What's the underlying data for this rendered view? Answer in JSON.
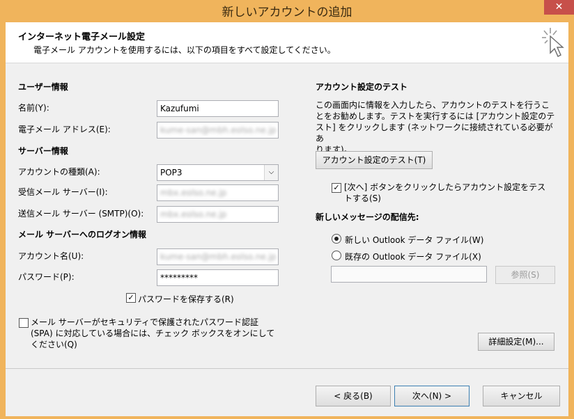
{
  "window": {
    "title": "新しいアカウントの追加",
    "close_glyph": "✕"
  },
  "header": {
    "title": "インターネット電子メール設定",
    "subtitle": "電子メール アカウントを使用するには、以下の項目をすべて設定してください。"
  },
  "user_info": {
    "section": "ユーザー情報",
    "name_label": "名前(Y):",
    "name_value": "Kazufumi",
    "email_label": "電子メール アドレス(E):",
    "email_value": "kume-san@mbh.eolso.ne.jp"
  },
  "server_info": {
    "section": "サーバー情報",
    "account_type_label": "アカウントの種類(A):",
    "account_type_value": "POP3",
    "incoming_label": "受信メール サーバー(I):",
    "incoming_value": "mbx.eolso.ne.jp",
    "outgoing_label": "送信メール サーバー (SMTP)(O):",
    "outgoing_value": "mbx.eolso.ne.jp"
  },
  "logon_info": {
    "section": "メール サーバーへのログオン情報",
    "account_name_label": "アカウント名(U):",
    "account_name_value": "kume-san@mbh.eolso.ne.jp",
    "password_label": "パスワード(P):",
    "password_value": "*********",
    "save_password_label": "パスワードを保存する(R)",
    "spa_label_1": "メール サーバーがセキュリティで保護されたパスワード認証",
    "spa_label_2": "(SPA) に対応している場合には、チェック ボックスをオンにして",
    "spa_label_3": "ください(Q)"
  },
  "test": {
    "section": "アカウント設定のテスト",
    "desc_1": "この画面内に情報を入力したら、アカウントのテストを行うこ",
    "desc_2": "とをお勧めします。テストを実行するには [アカウント設定のテ",
    "desc_3": "スト] をクリックします (ネットワークに接続されている必要があ",
    "desc_4": "ります)。",
    "test_button": "アカウント設定のテスト(T)",
    "auto_test_1": "[次へ] ボタンをクリックしたらアカウント設定をテス",
    "auto_test_2": "トする(S)"
  },
  "delivery": {
    "section": "新しいメッセージの配信先:",
    "new_file": "新しい Outlook データ ファイル(W)",
    "existing_file": "既存の Outlook データ ファイル(X)",
    "path_value": "",
    "browse_button": "参照(S)"
  },
  "buttons": {
    "more_settings": "詳細設定(M)...",
    "back": "< 戻る(B)",
    "next": "次へ(N) >",
    "cancel": "キャンセル"
  },
  "checkbox_glyph": "✓",
  "select_arrow_glyph": "⌵",
  "colors": {
    "titlebar": "#f0b45c",
    "close": "#c7504a"
  }
}
